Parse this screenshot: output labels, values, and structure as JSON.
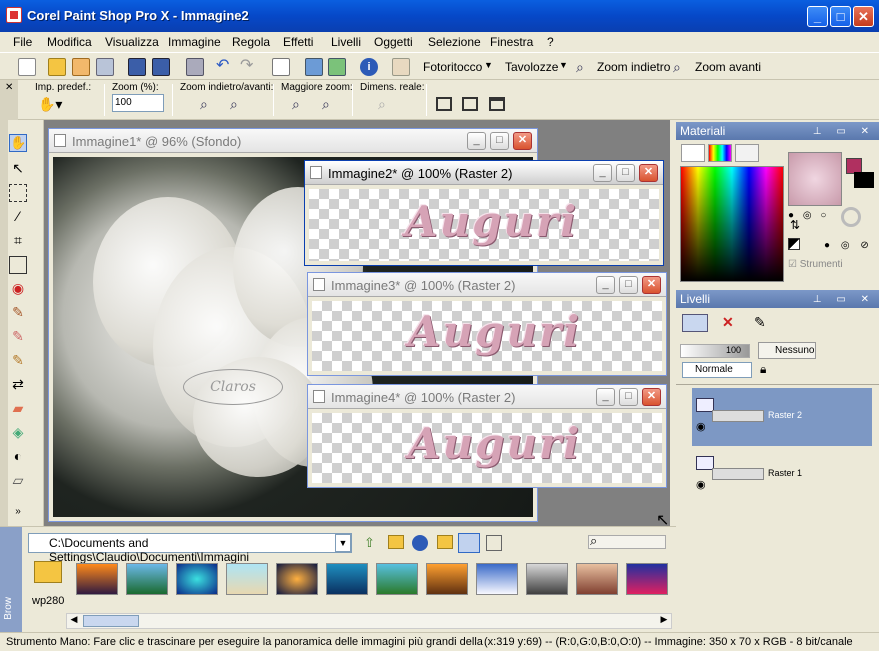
{
  "window": {
    "title": "Corel Paint Shop Pro X - Immagine2"
  },
  "menu": [
    "File",
    "Modifica",
    "Visualizza",
    "Immagine",
    "Regola",
    "Effetti",
    "Livelli",
    "Oggetti",
    "Selezione",
    "Finestra",
    "?"
  ],
  "toolbar": {
    "fotoritocco": "Fotoritocco",
    "tavolozze": "Tavolozze",
    "zoom_indietro": "Zoom indietro",
    "zoom_avanti": "Zoom avanti"
  },
  "tool_options": {
    "preset_label": "Imp. predef.:",
    "zoom_label": "Zoom (%):",
    "zoom_value": "100",
    "zoom_inout_label": "Zoom indietro/avanti:",
    "zoom_max_label": "Maggiore zoom:",
    "real_size_label": "Dimens. reale:"
  },
  "documents": [
    {
      "title": "Immagine1* @  96% (Sfondo)",
      "watermark": "Claros"
    },
    {
      "title": "Immagine2* @ 100% (Raster 2)",
      "text": "Auguri"
    },
    {
      "title": "Immagine3* @ 100% (Raster 2)",
      "text": "Auguri"
    },
    {
      "title": "Immagine4* @ 100% (Raster 2)",
      "text": "Auguri"
    }
  ],
  "materials": {
    "title": "Materiali",
    "tools_checkbox": "Strumenti"
  },
  "layers": {
    "title": "Livelli",
    "opacity": "100",
    "blend_mode": "Normale",
    "none_button": "Nessuno",
    "items": [
      {
        "name": "Raster 2",
        "selected": true
      },
      {
        "name": "Raster 1",
        "selected": false
      }
    ]
  },
  "browser": {
    "path": "C:\\Documents and Settings\\Claudio\\Documenti\\Immagini",
    "folder_name": "wp280",
    "side_label": "Brow"
  },
  "status": {
    "message": "Strumento Mano: Fare clic e trascinare per eseguire la panoramica delle immagini più grandi della",
    "info": "(x:319 y:69) -- (R:0,G:0,B:0,O:0) -- Immagine:  350 x 70 x RGB - 8 bit/canale"
  },
  "colors": {
    "titlebar": "#0648c8",
    "panel_header": "#5a78ad",
    "selected_layer": "#7d98c4",
    "foreground_swatch": "#b03060"
  }
}
